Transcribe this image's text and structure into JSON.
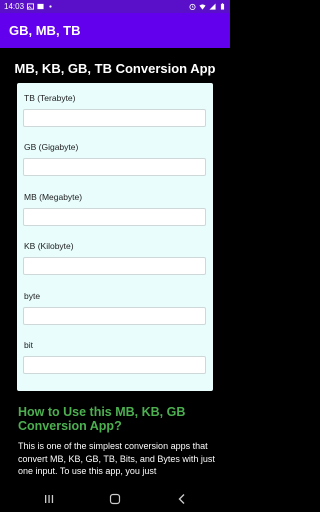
{
  "status_bar": {
    "time": "14:03",
    "icons_left": [
      "gallery-icon",
      "photo-icon",
      "dot-icon"
    ],
    "icons_right": [
      "alarm-icon",
      "wifi-icon",
      "signal-icon",
      "battery-icon"
    ]
  },
  "app_bar": {
    "title": "GB, MB, TB"
  },
  "main": {
    "heading": "MB, KB, GB, TB Conversion App",
    "fields": [
      {
        "label": "TB (Terabyte)",
        "value": ""
      },
      {
        "label": "GB (Gigabyte)",
        "value": ""
      },
      {
        "label": "MB (Megabyte)",
        "value": ""
      },
      {
        "label": "KB (Kilobyte)",
        "value": ""
      },
      {
        "label": "byte",
        "value": ""
      },
      {
        "label": "bit",
        "value": ""
      }
    ],
    "howto_title": "How to Use this MB, KB, GB Conversion App?",
    "body_text": "This is one of the simplest conversion apps that convert MB, KB, GB, TB, Bits, and Bytes with just one input. To use this app, you just"
  },
  "nav_bar": {
    "buttons": [
      "recents-button",
      "home-button",
      "back-button"
    ]
  },
  "colors": {
    "status_bar": "#5a10c8",
    "app_bar": "#6200ee",
    "card": "#e9fdfd",
    "accent_green": "#4caf50"
  }
}
